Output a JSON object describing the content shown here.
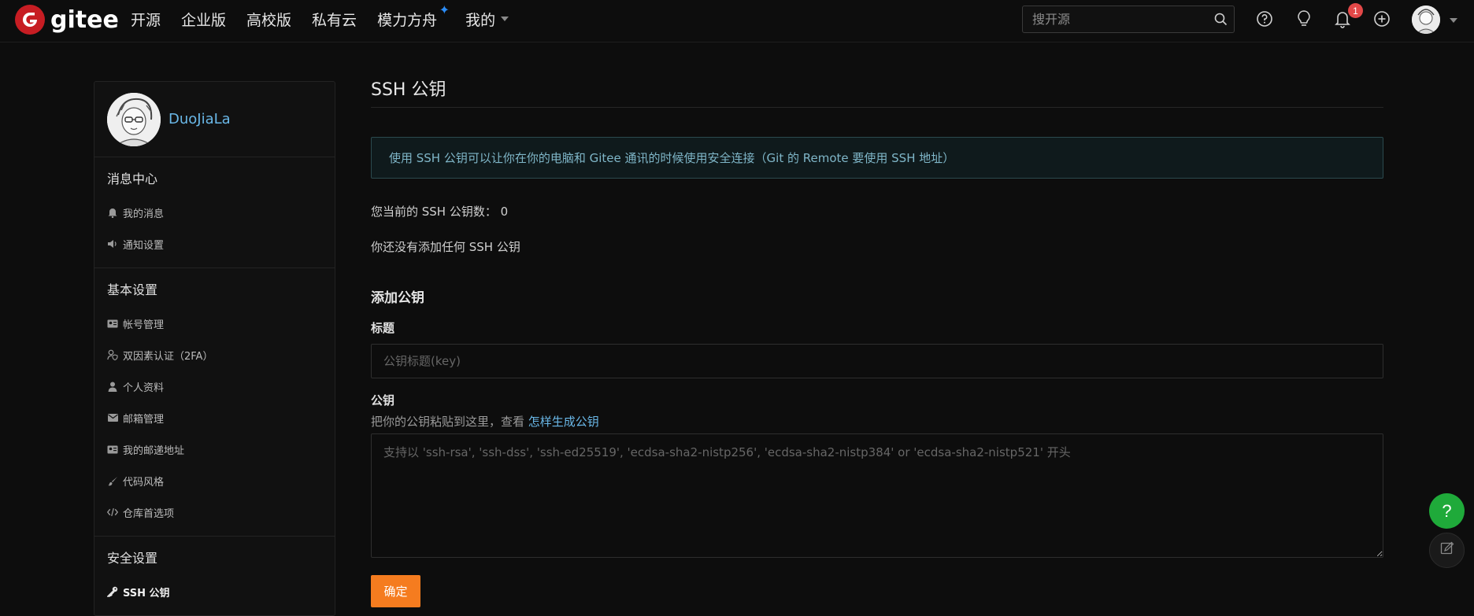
{
  "header": {
    "logo_text": "gitee",
    "nav": [
      {
        "label": "开源"
      },
      {
        "label": "企业版"
      },
      {
        "label": "高校版"
      },
      {
        "label": "私有云"
      },
      {
        "label": "模力方舟"
      },
      {
        "label": "我的"
      }
    ],
    "search_placeholder": "搜开源",
    "notification_count": "1",
    "icons": [
      "help-circle-icon",
      "lightbulb-icon",
      "bell-icon",
      "plus-circle-icon"
    ]
  },
  "sidebar": {
    "username": "DuoJiaLa",
    "groups": [
      {
        "title": "消息中心",
        "items": [
          {
            "label": "我的消息",
            "icon": "bell-icon"
          },
          {
            "label": "通知设置",
            "icon": "speaker-icon"
          }
        ]
      },
      {
        "title": "基本设置",
        "items": [
          {
            "label": "帐号管理",
            "icon": "id-card-icon"
          },
          {
            "label": "双因素认证（2FA）",
            "icon": "user-shield-icon"
          },
          {
            "label": "个人资料",
            "icon": "user-icon"
          },
          {
            "label": "邮箱管理",
            "icon": "mail-icon"
          },
          {
            "label": "我的邮递地址",
            "icon": "address-card-icon"
          },
          {
            "label": "代码风格",
            "icon": "brush-icon"
          },
          {
            "label": "仓库首选项",
            "icon": "code-icon"
          }
        ]
      },
      {
        "title": "安全设置",
        "items": [
          {
            "label": "SSH 公钥",
            "icon": "key-icon",
            "active": true
          }
        ]
      }
    ]
  },
  "main": {
    "title": "SSH 公钥",
    "info": "使用 SSH 公钥可以让你在你的电脑和 Gitee 通讯的时候使用安全连接（Git 的 Remote 要使用 SSH 地址）",
    "count_text": "您当前的 SSH 公钥数：  0",
    "empty_text": "你还没有添加任何 SSH 公钥",
    "section_title": "添加公钥",
    "title_label": "标题",
    "title_placeholder": "公钥标题(key)",
    "key_label": "公钥",
    "key_hint": "把你的公钥粘贴到这里，查看 ",
    "key_hint_link": "怎样生成公钥",
    "key_placeholder": "支持以 'ssh-rsa', 'ssh-dss', 'ssh-ed25519', 'ecdsa-sha2-nistp256', 'ecdsa-sha2-nistp384' or 'ecdsa-sha2-nistp521' 开头",
    "submit_label": "确定"
  },
  "floating": {
    "help_label": "?"
  },
  "colors": {
    "accent": "#f57c1f",
    "link": "#6ab8e8",
    "brand": "#c71d23",
    "help_button": "#1faa3a"
  }
}
